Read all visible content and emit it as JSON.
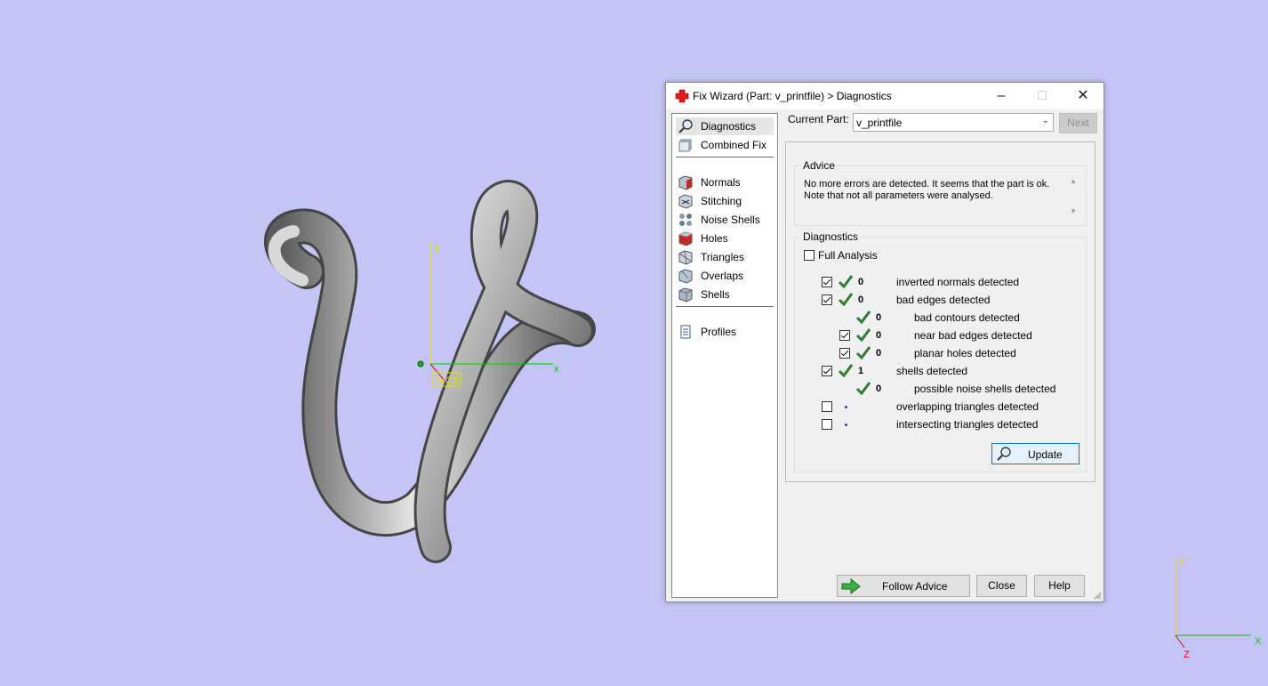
{
  "window": {
    "title": "Fix Wizard (Part: v_printfile) > Diagnostics",
    "controls": [
      "minimize",
      "maximize",
      "close"
    ]
  },
  "viewport": {
    "background": "#c4c4f7",
    "axis_labels": {
      "x": "x",
      "y": "y",
      "z": "Z"
    },
    "wcs_label": "WCS",
    "corner_axes": {
      "x": "X",
      "y": "Y",
      "z": "Z"
    }
  },
  "sidebar": {
    "items": [
      {
        "label": "Diagnostics",
        "icon": "magnifier-icon",
        "selected": true
      },
      {
        "label": "Combined Fix",
        "icon": "combined-fix-icon"
      },
      {
        "label": "Normals",
        "icon": "normals-icon"
      },
      {
        "label": "Stitching",
        "icon": "stitching-icon"
      },
      {
        "label": "Noise Shells",
        "icon": "noise-shells-icon"
      },
      {
        "label": "Holes",
        "icon": "holes-icon"
      },
      {
        "label": "Triangles",
        "icon": "triangles-icon"
      },
      {
        "label": "Overlaps",
        "icon": "overlaps-icon"
      },
      {
        "label": "Shells",
        "icon": "shells-icon"
      },
      {
        "label": "Profiles",
        "icon": "profiles-icon"
      }
    ]
  },
  "header": {
    "current_part_label": "Current Part:",
    "current_part_value": "v_printfile",
    "next_label": "Next"
  },
  "advice": {
    "title": "Advice",
    "text": "No more errors are detected. It seems that the part is ok. Note that not all parameters were analysed."
  },
  "diagnostics": {
    "title": "Diagnostics",
    "full_analysis_label": "Full Analysis",
    "full_analysis_checked": false,
    "rows": [
      {
        "checkbox": true,
        "checked": true,
        "status": "ok",
        "count": "0",
        "label": "inverted normals detected"
      },
      {
        "checkbox": true,
        "checked": true,
        "status": "ok",
        "count": "0",
        "label": "bad edges detected"
      },
      {
        "checkbox": false,
        "status": "ok",
        "count": "0",
        "label": "bad contours detected"
      },
      {
        "checkbox": true,
        "checked": true,
        "status": "ok",
        "count": "0",
        "label": "near bad edges detected"
      },
      {
        "checkbox": true,
        "checked": true,
        "status": "ok",
        "count": "0",
        "label": "planar holes detected"
      },
      {
        "checkbox": true,
        "checked": true,
        "status": "ok",
        "count": "1",
        "label": "shells detected"
      },
      {
        "checkbox": false,
        "status": "ok",
        "count": "0",
        "label": "possible noise shells detected"
      },
      {
        "checkbox": true,
        "checked": false,
        "status": "pending",
        "count": "",
        "label": "overlapping triangles detected"
      },
      {
        "checkbox": true,
        "checked": false,
        "status": "pending",
        "count": "",
        "label": "intersecting triangles detected"
      }
    ],
    "update_label": "Update"
  },
  "footer": {
    "follow_advice_label": "Follow Advice",
    "close_label": "Close",
    "help_label": "Help"
  },
  "colors": {
    "tick_green": "#2e7d32",
    "accent_blue": "#0078d7"
  }
}
